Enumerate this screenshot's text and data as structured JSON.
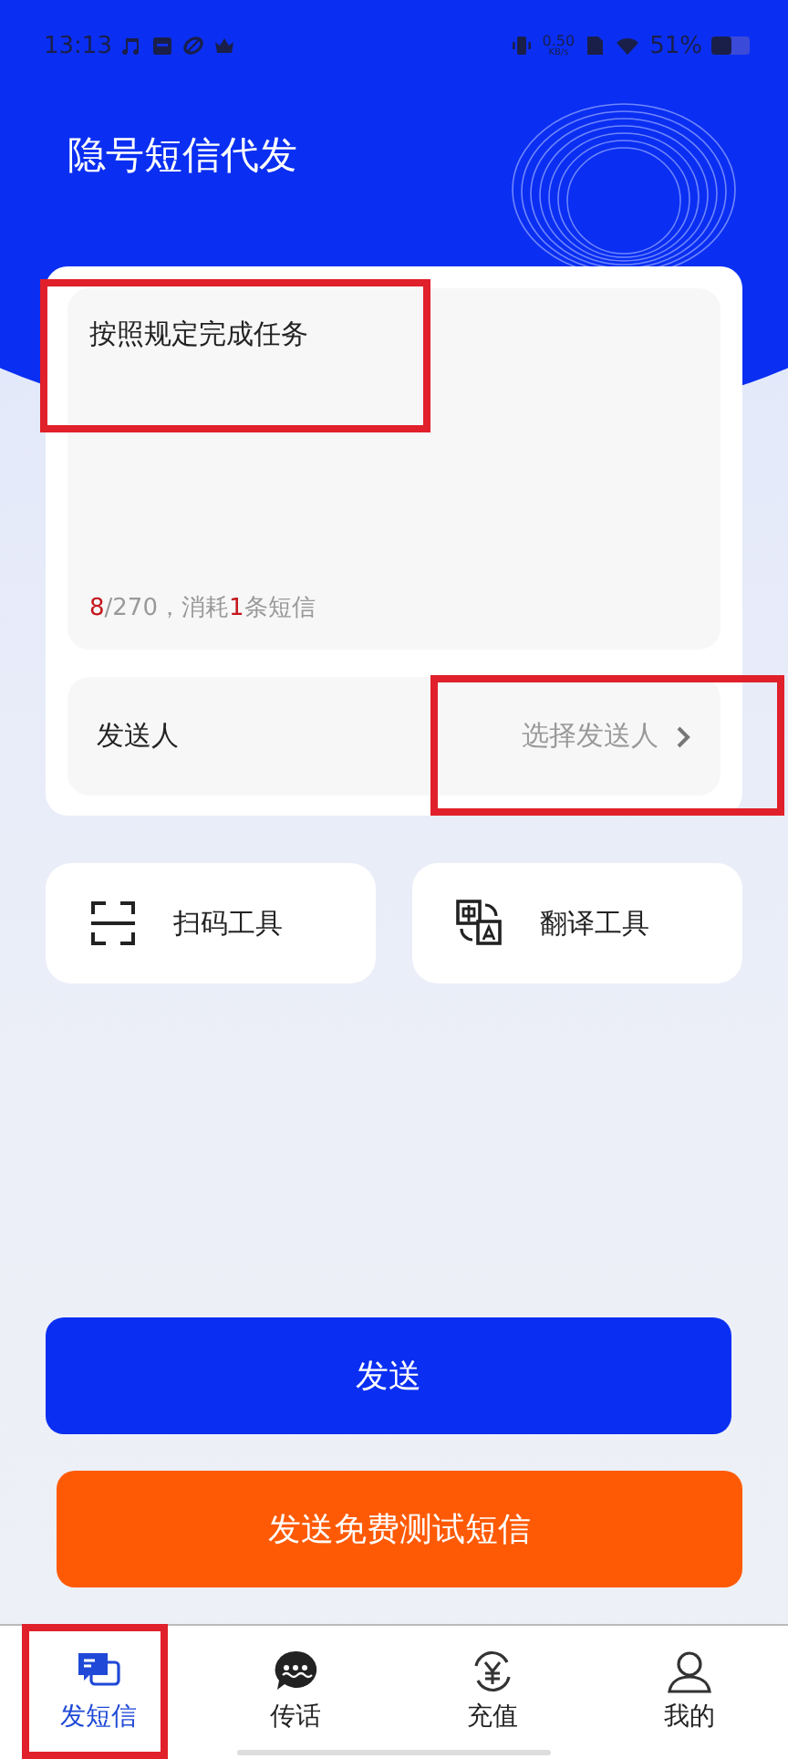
{
  "status_bar": {
    "time": "13:13",
    "speed": "0.50",
    "speed_unit": "KB/s",
    "battery": "51%"
  },
  "title": "隐号短信代发",
  "message": {
    "value": "按照规定完成任务",
    "counter": {
      "typed": "8",
      "limit": "/270，消耗",
      "messages": "1",
      "unit": "条短信"
    }
  },
  "sender": {
    "label": "发送人",
    "placeholder": "选择发送人"
  },
  "tools": [
    {
      "kind": "scan",
      "label": "扫码工具"
    },
    {
      "kind": "translate",
      "label": "翻译工具"
    }
  ],
  "send_button": "发送",
  "test_button": "发送免费测试短信",
  "tabs": [
    {
      "kind": "sms",
      "label": "发短信",
      "selected": true
    },
    {
      "kind": "chat",
      "label": "传话",
      "selected": false
    },
    {
      "kind": "recharge",
      "label": "充值",
      "selected": false
    },
    {
      "kind": "me",
      "label": "我的",
      "selected": false
    }
  ]
}
